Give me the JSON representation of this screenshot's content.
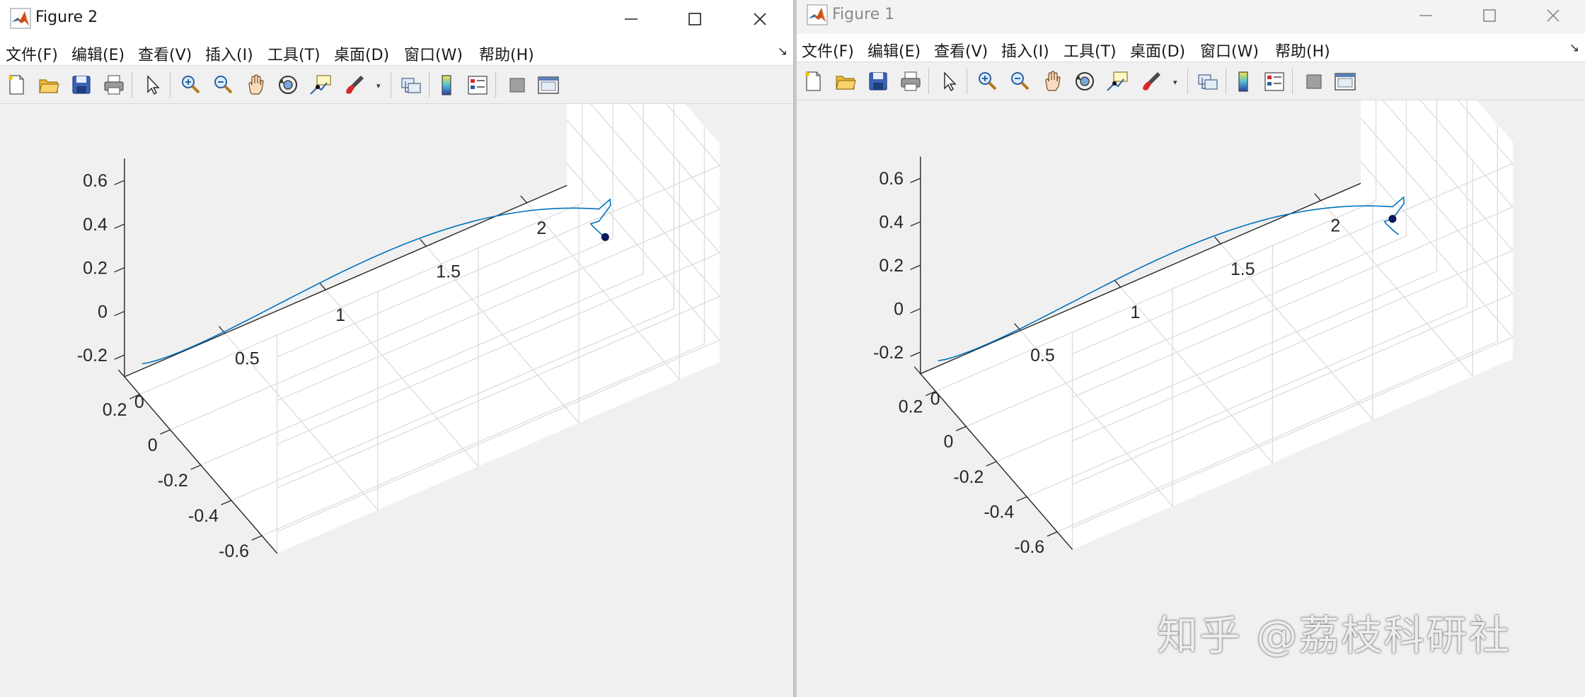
{
  "windows": [
    {
      "id": "fig2",
      "title": "Figure 2",
      "menus": [
        "文件(F)",
        "编辑(E)",
        "查看(V)",
        "插入(I)",
        "工具(T)",
        "桌面(D)",
        "窗口(W)",
        "帮助(H)"
      ],
      "point": "end"
    },
    {
      "id": "fig1",
      "title": "Figure 1",
      "menus": [
        "文件(F)",
        "编辑(E)",
        "查看(V)",
        "插入(I)",
        "工具(T)",
        "桌面(D)",
        "窗口(W)",
        "帮助(H)"
      ],
      "point": "top"
    }
  ],
  "toolbar_icons": [
    "new-figure-icon",
    "open-file-icon",
    "save-icon",
    "print-icon",
    "edit-plot-pointer-icon",
    "zoom-in-icon",
    "zoom-out-icon",
    "pan-hand-icon",
    "rotate-3d-icon",
    "data-cursor-icon",
    "brush-icon",
    "link-plot-icon",
    "colorbar-icon",
    "legend-icon",
    "hide-plot-tools-icon",
    "show-plot-tools-icon"
  ],
  "chart_data": [
    {
      "type": "line",
      "projection": "3d",
      "series": [
        {
          "color": "#0072bd",
          "marker": "end"
        }
      ],
      "x_ticks": [
        "0",
        "0.5",
        "1",
        "1.5",
        "2"
      ],
      "y_ticks": [
        "0.2",
        "0",
        "-0.2",
        "-0.4",
        "-0.6"
      ],
      "z_ticks": [
        "0.6",
        "0.4",
        "0.2",
        "0",
        "-0.2"
      ],
      "grid": true
    },
    {
      "type": "line",
      "projection": "3d",
      "series": [
        {
          "color": "#0072bd",
          "marker": "near-top"
        }
      ],
      "x_ticks": [
        "0",
        "0.5",
        "1",
        "1.5",
        "2"
      ],
      "y_ticks": [
        "0.2",
        "0",
        "-0.2",
        "-0.4",
        "-0.6"
      ],
      "z_ticks": [
        "0.6",
        "0.4",
        "0.2",
        "0",
        "-0.2"
      ],
      "grid": true
    }
  ],
  "watermark": "知乎 @荔枝科研社",
  "colors": {
    "line": "#0072bd",
    "marker": "#0b1a66",
    "axes_bg": "#ffffff",
    "figure_bg": "#f0f0f0",
    "grid": "#dcdcdc"
  }
}
